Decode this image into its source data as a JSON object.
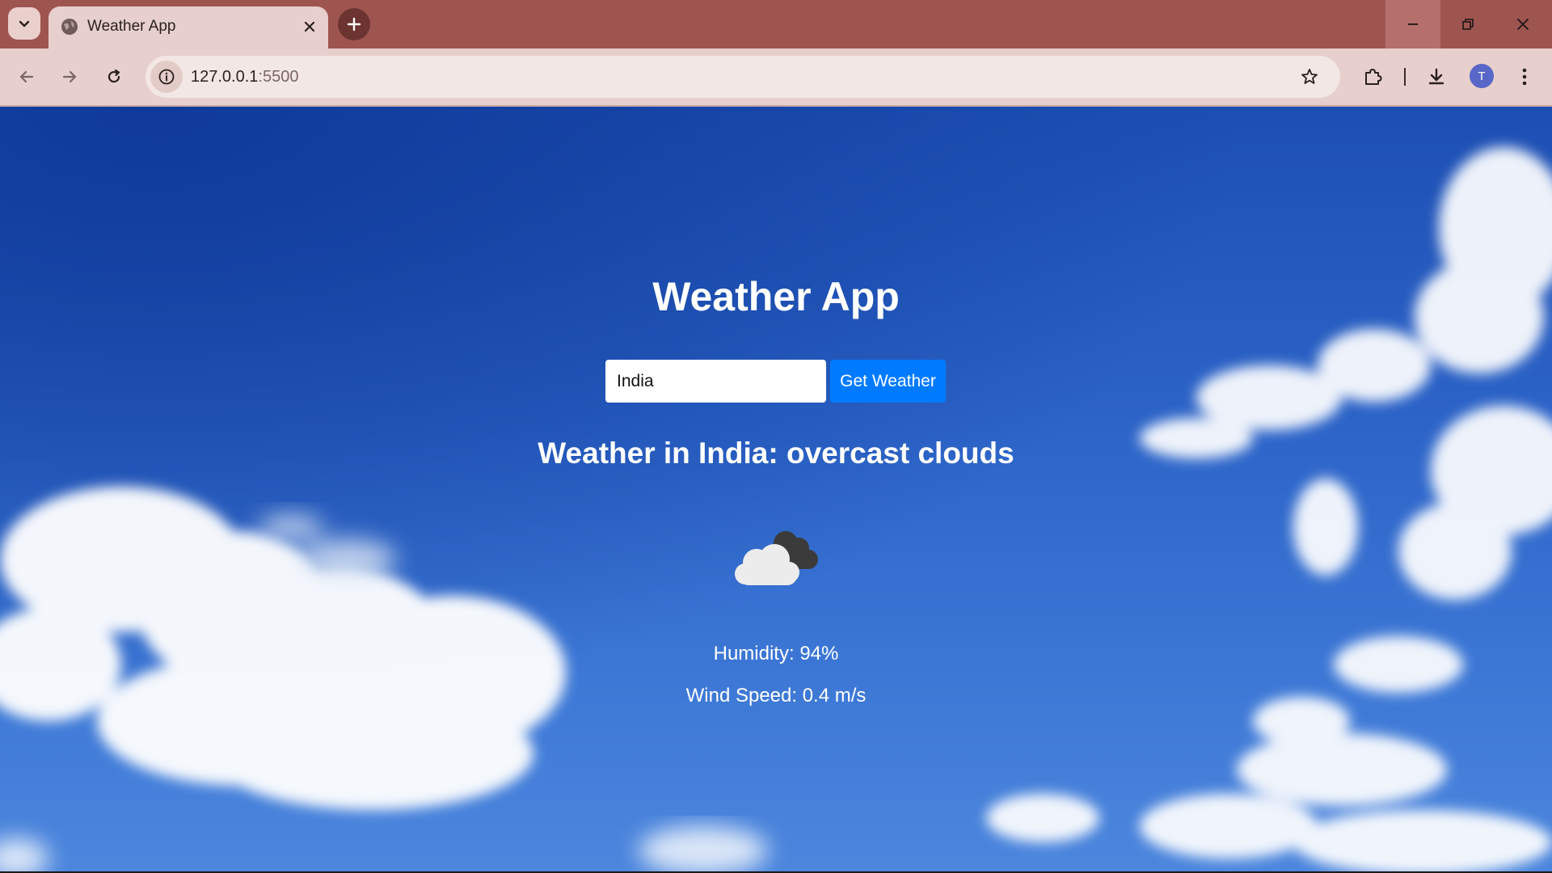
{
  "browser": {
    "tab": {
      "title": "Weather App",
      "favicon_icon": "globe-icon",
      "close_icon": "close-icon"
    },
    "tab_search_icon": "chevron-down-icon",
    "new_tab_icon": "plus-icon",
    "window_controls": {
      "minimize_icon": "minimize-icon",
      "restore_icon": "restore-icon",
      "close_icon": "close-icon"
    },
    "toolbar": {
      "back_icon": "arrow-left-icon",
      "forward_icon": "arrow-right-icon",
      "reload_icon": "reload-icon",
      "site_info_icon": "info-icon",
      "url_host": "127.0.0.1",
      "url_port": ":5500",
      "bookmark_icon": "star-icon",
      "extensions_icon": "puzzle-icon",
      "download_icon": "download-icon",
      "avatar_letter": "T",
      "menu_icon": "kebab-menu-icon"
    },
    "colors": {
      "tabstrip": "#9e5550",
      "toolbar": "#e6cfcc",
      "avatar": "#5866c8"
    }
  },
  "app": {
    "title": "Weather App",
    "search": {
      "value": "India",
      "button_label": "Get Weather"
    },
    "result": {
      "description": "Weather in India: overcast clouds",
      "icon": "overcast-clouds-icon",
      "humidity": "Humidity: 94%",
      "wind_speed": "Wind Speed: 0.4 m/s"
    },
    "colors": {
      "button": "#007bff",
      "text": "#ffffff",
      "sky": "#2c63c7"
    }
  }
}
